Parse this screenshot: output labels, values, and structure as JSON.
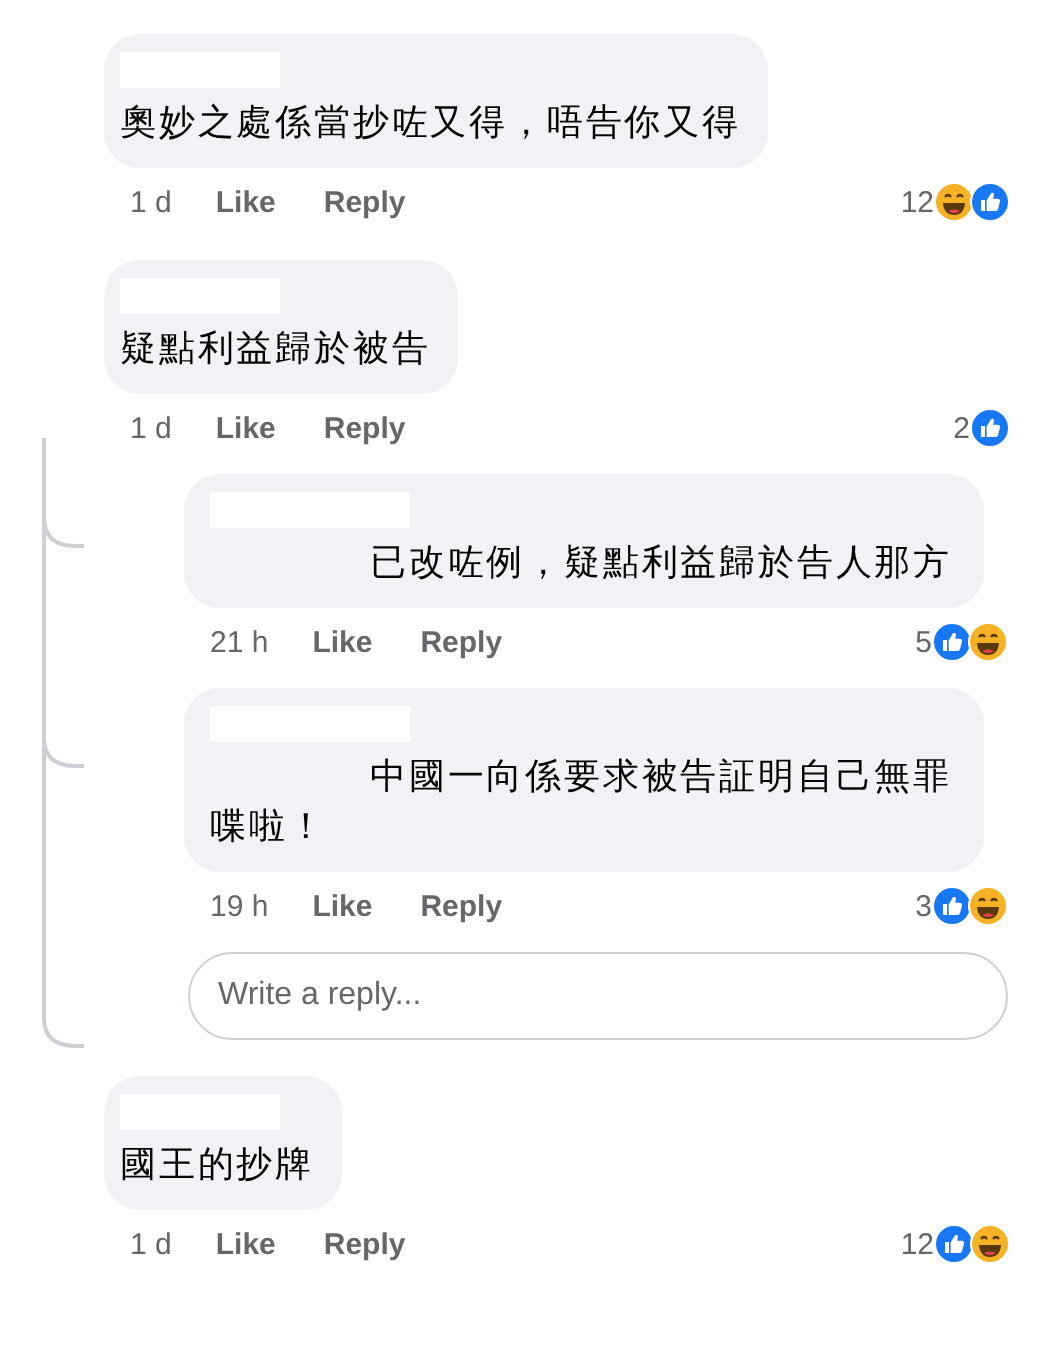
{
  "comments": [
    {
      "text": "奧妙之處係當抄咗又得，唔告你又得",
      "time": "1 d",
      "like": "Like",
      "reply": "Reply",
      "count": "12",
      "reactions": [
        {
          "kind": "haha"
        },
        {
          "kind": "like"
        }
      ]
    },
    {
      "text": "疑點利益歸於被告",
      "time": "1 d",
      "like": "Like",
      "reply": "Reply",
      "count": "2",
      "reactions": [
        {
          "kind": "like"
        }
      ],
      "replies": [
        {
          "text": "已改咗例，疑點利益歸於告人那方",
          "time": "21 h",
          "like": "Like",
          "reply": "Reply",
          "count": "5",
          "reactions": [
            {
              "kind": "like"
            },
            {
              "kind": "haha"
            }
          ]
        },
        {
          "text": "中國一向係要求被告証明自己無罪喋啦！",
          "time": "19 h",
          "like": "Like",
          "reply": "Reply",
          "count": "3",
          "reactions": [
            {
              "kind": "like"
            },
            {
              "kind": "haha"
            }
          ]
        }
      ],
      "reply_box": {
        "placeholder": "Write a reply..."
      }
    },
    {
      "text": "國王的抄牌",
      "time": "1 d",
      "like": "Like",
      "reply": "Reply",
      "count": "12",
      "reactions": [
        {
          "kind": "like"
        },
        {
          "kind": "haha"
        }
      ]
    }
  ]
}
